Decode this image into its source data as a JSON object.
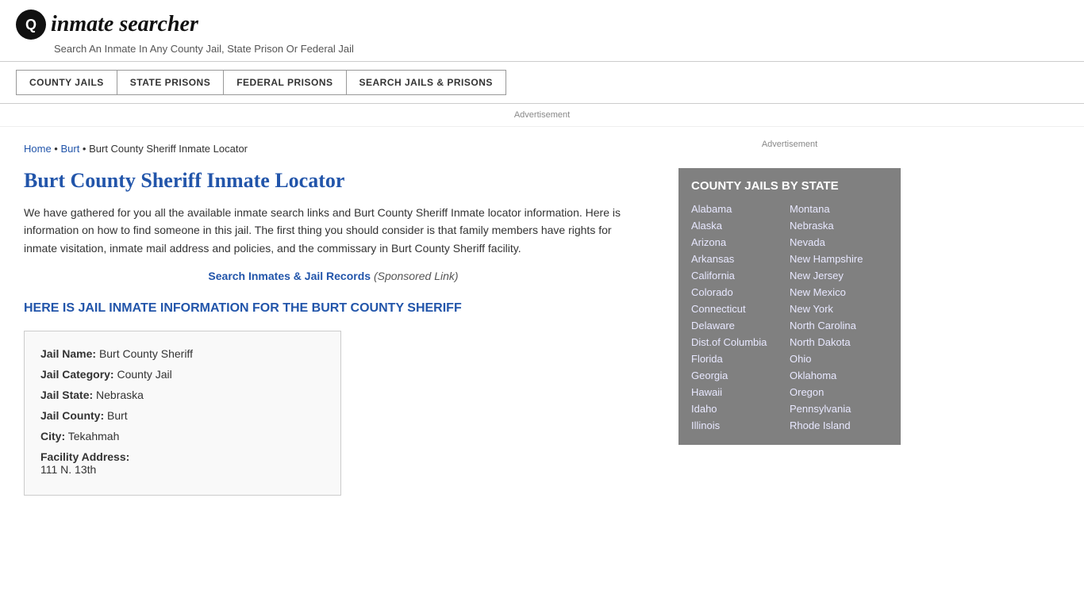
{
  "header": {
    "logo_icon": "🔍",
    "logo_text": "inmate searcher",
    "tagline": "Search An Inmate In Any County Jail, State Prison Or Federal Jail"
  },
  "nav": {
    "items": [
      {
        "label": "COUNTY JAILS",
        "id": "county-jails"
      },
      {
        "label": "STATE PRISONS",
        "id": "state-prisons"
      },
      {
        "label": "FEDERAL PRISONS",
        "id": "federal-prisons"
      },
      {
        "label": "SEARCH JAILS & PRISONS",
        "id": "search-jails"
      }
    ]
  },
  "ad_top": {
    "label": "Advertisement"
  },
  "breadcrumb": {
    "home": "Home",
    "separator1": " • ",
    "burt": "Burt",
    "separator2": " • ",
    "current": "Burt County Sheriff Inmate Locator"
  },
  "page_title": "Burt County Sheriff Inmate Locator",
  "description": "We have gathered for you all the available inmate search links and Burt County Sheriff Inmate locator information. Here is information on how to find someone in this jail. The first thing you should consider is that family members have rights for inmate visitation, inmate mail address and policies, and the commissary in Burt County Sheriff facility.",
  "search_link": {
    "text": "Search Inmates & Jail Records",
    "sponsored": "(Sponsored Link)"
  },
  "jail_heading": "HERE IS JAIL INMATE INFORMATION FOR THE BURT COUNTY SHERIFF",
  "info_box": {
    "jail_name_label": "Jail Name:",
    "jail_name_value": "Burt County Sheriff",
    "jail_category_label": "Jail Category:",
    "jail_category_value": "County Jail",
    "jail_state_label": "Jail State:",
    "jail_state_value": "Nebraska",
    "jail_county_label": "Jail County:",
    "jail_county_value": "Burt",
    "city_label": "City:",
    "city_value": "Tekahmah",
    "facility_address_label": "Facility Address:",
    "facility_address_value": "111 N. 13th"
  },
  "sidebar": {
    "ad_label": "Advertisement",
    "state_box_title": "COUNTY JAILS BY STATE",
    "states_left": [
      "Alabama",
      "Alaska",
      "Arizona",
      "Arkansas",
      "California",
      "Colorado",
      "Connecticut",
      "Delaware",
      "Dist.of Columbia",
      "Florida",
      "Georgia",
      "Hawaii",
      "Idaho",
      "Illinois"
    ],
    "states_right": [
      "Montana",
      "Nebraska",
      "Nevada",
      "New Hampshire",
      "New Jersey",
      "New Mexico",
      "New York",
      "North Carolina",
      "North Dakota",
      "Ohio",
      "Oklahoma",
      "Oregon",
      "Pennsylvania",
      "Rhode Island"
    ]
  }
}
